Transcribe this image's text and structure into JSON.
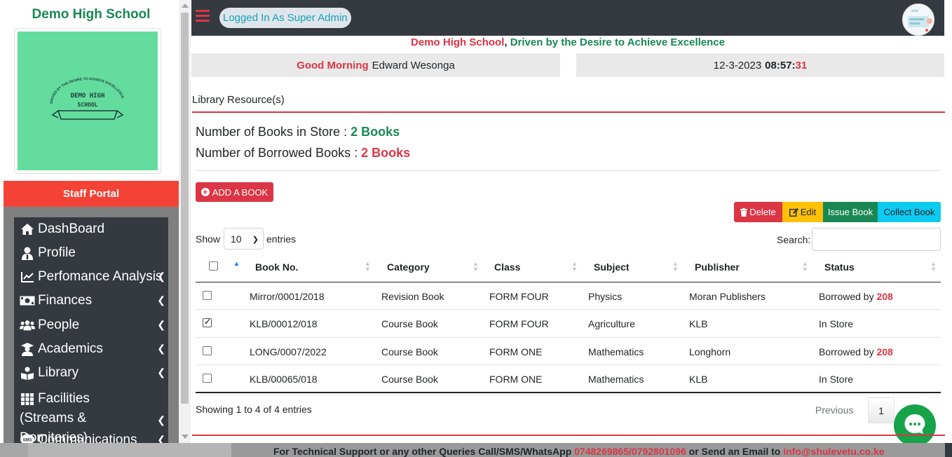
{
  "sidebar": {
    "school_name": "Demo High School",
    "logo_text": "DEMO HIGH SCHOOL",
    "logo_arc_text": "DRIVEN BY THE DESIRE TO ACHIEVE EXCELLENCE",
    "portal_label": "Staff Portal",
    "menu": [
      {
        "label": "DashBoard",
        "icon": "home-icon",
        "has_submenu": false
      },
      {
        "label": "Profile",
        "icon": "user-tie-icon",
        "has_submenu": false
      },
      {
        "label": "Perfomance Analysis",
        "icon": "chart-line-icon",
        "has_submenu": true
      },
      {
        "label": "Finances",
        "icon": "money-icon",
        "has_submenu": true
      },
      {
        "label": "People",
        "icon": "users-icon",
        "has_submenu": true
      },
      {
        "label": "Academics",
        "icon": "graduate-icon",
        "has_submenu": true
      },
      {
        "label": "Library",
        "icon": "book-reader-icon",
        "has_submenu": true
      },
      {
        "label": "Facilities (Streams & Domitories)",
        "icon": "grid-icon",
        "has_submenu": true
      },
      {
        "label": "Communications",
        "icon": "sms-icon",
        "has_submenu": true
      }
    ]
  },
  "topbar": {
    "login_status": "Logged In As Super Admin"
  },
  "tagline": {
    "school": "Demo High School",
    "comma": ",",
    "motto": " Driven by the Desire to Achieve Excellence"
  },
  "greeting": {
    "salutation": "Good Morning",
    "name": "Edward Wesonga"
  },
  "datetime": {
    "date": "12-3-2023",
    "time": "08:57:",
    "seconds": "31"
  },
  "page": {
    "section_title": "Library Resource(s)",
    "books_in_store_label": "Number of Books in Store : ",
    "books_in_store_value": "2 Books",
    "borrowed_label": "Number of Borrowed Books : ",
    "borrowed_value": "2 Books",
    "add_button": "ADD A BOOK"
  },
  "actions": {
    "delete": "Delete",
    "edit": "Edit",
    "issue": "Issue Book",
    "collect": "Collect Book"
  },
  "table_controls": {
    "show": "Show",
    "page_size": "10",
    "entries": "entries",
    "search_label": "Search:",
    "search_value": ""
  },
  "table": {
    "headers": [
      "Book No.",
      "Category",
      "Class",
      "Subject",
      "Publisher",
      "Status"
    ],
    "rows": [
      {
        "checked": false,
        "book_no": "Mirror/0001/2018",
        "category": "Revision Book",
        "class": "FORM FOUR",
        "subject": "Physics",
        "publisher": "Moran Publishers",
        "status": "Borrowed by ",
        "status_num": "208"
      },
      {
        "checked": true,
        "book_no": "KLB/00012/018",
        "category": "Course Book",
        "class": "FORM FOUR",
        "subject": "Agriculture",
        "publisher": "KLB",
        "status": "In Store",
        "status_num": ""
      },
      {
        "checked": false,
        "book_no": "LONG/0007/2022",
        "category": "Course Book",
        "class": "FORM ONE",
        "subject": "Mathematics",
        "publisher": "Longhorn",
        "status": "Borrowed by ",
        "status_num": "208"
      },
      {
        "checked": false,
        "book_no": "KLB/00065/018",
        "category": "Course Book",
        "class": "FORM ONE",
        "subject": "Mathematics",
        "publisher": "KLB",
        "status": "In Store",
        "status_num": ""
      }
    ]
  },
  "pagination": {
    "info": "Showing 1 to 4 of 4 entries",
    "previous": "Previous",
    "current_page": "1"
  },
  "footer": {
    "text": "For Technical Support or any other Queries Call/SMS/WhatsApp ",
    "phones": "0748269865/0792801096",
    "mid": " or Send an Email to ",
    "email": "info@shulevetu.co.ke"
  },
  "colors": {
    "brand_green": "#198754",
    "brand_red": "#dc3545",
    "sidebar_dark": "#343a40",
    "logo_bg": "#63dc9e"
  }
}
